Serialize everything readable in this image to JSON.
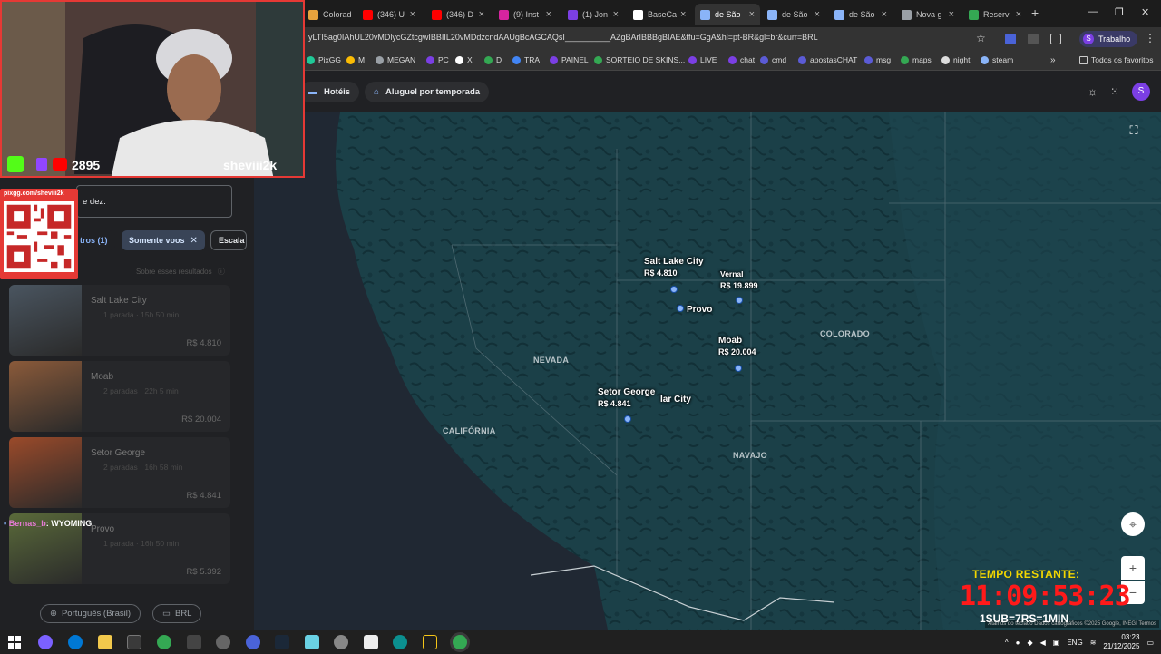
{
  "browser": {
    "tabs": [
      {
        "label": "Colorad",
        "color": "#e8a33d"
      },
      {
        "label": "(346) U",
        "color": "#ff0000"
      },
      {
        "label": "(346) D",
        "color": "#ff0000"
      },
      {
        "label": "(9) Inst",
        "color": "#d6249f"
      },
      {
        "label": "(1) Jon",
        "color": "#7b3fe4"
      },
      {
        "label": "BaseCa",
        "color": "#ffffff"
      },
      {
        "label": "de São",
        "color": "#8ab4f8",
        "active": true
      },
      {
        "label": "de São",
        "color": "#8ab4f8"
      },
      {
        "label": "de São",
        "color": "#8ab4f8"
      },
      {
        "label": "Nova g",
        "color": "#9aa0a6"
      },
      {
        "label": "Reserv",
        "color": "#34a853"
      }
    ],
    "url": "yLTI5ag0IAhUL20vMDlycGZtcgwIBBIIL20vMDdzcndAAUgBcAGCAQsI__________AZgBArIBBBgBIAE&tfu=GgA&hl=pt-BR&gl=br&curr=BRL",
    "profile_label": "Trabalho",
    "profile_initial": "S",
    "bookmarks": [
      {
        "label": "PixGG",
        "color": "#20c997"
      },
      {
        "label": "M",
        "color": "#fbbc04"
      },
      {
        "label": "MEGAN",
        "color": "#9aa0a6"
      },
      {
        "label": "PC",
        "color": "#7b3fe4"
      },
      {
        "label": "X",
        "color": "#ffffff"
      },
      {
        "label": "D",
        "color": "#34a853"
      },
      {
        "label": "TRA",
        "color": "#4285f4"
      },
      {
        "label": "PAINEL",
        "color": "#7b3fe4"
      },
      {
        "label": "SORTEIO DE SKINS...",
        "color": "#34a853"
      },
      {
        "label": "LIVE",
        "color": "#7b3fe4"
      },
      {
        "label": "chat",
        "color": "#7b3fe4"
      },
      {
        "label": "cmd",
        "color": "#5b5bd6"
      },
      {
        "label": "apostasCHAT",
        "color": "#5b5bd6"
      },
      {
        "label": "msg",
        "color": "#5b5bd6"
      },
      {
        "label": "maps",
        "color": "#34a853"
      },
      {
        "label": "night",
        "color": "#dddddd"
      },
      {
        "label": "steam",
        "color": "#8ab4f8"
      }
    ],
    "bookmarks_more": "Todos os favoritos"
  },
  "header": {
    "hotels_label": "Hotéis",
    "rentals_label": "Aluguel por temporada"
  },
  "sidebar": {
    "search_text": "e dez.",
    "filters_label": "tros (1)",
    "only_flights_label": "Somente voos",
    "stops_label": "Escala",
    "results_note": "Sobre esses resultados",
    "cards": [
      {
        "name": "Salt Lake City",
        "details": "1 parada · 15h 50 min",
        "price": "R$ 4.810",
        "color": "#4a5560"
      },
      {
        "name": "Moab",
        "details": "2 paradas · 22h 5 min",
        "price": "R$ 20.004",
        "color": "#8a5a3a"
      },
      {
        "name": "Setor George",
        "details": "2 paradas · 16h 58 min",
        "price": "R$ 4.841",
        "color": "#9a4a2a"
      },
      {
        "name": "Provo",
        "details": "1 parada · 16h 50 min",
        "price": "R$ 5.392",
        "color": "#5a6a3a"
      }
    ],
    "language_label": "Português (Brasil)",
    "currency_label": "BRL"
  },
  "map": {
    "regions": {
      "nevada": "NEVADA",
      "colorado": "COLORADO",
      "california": "CALIFÓRNIA",
      "navajo": "NAVAJO"
    },
    "destinations": [
      {
        "name": "Salt Lake City",
        "price": "R$ 4.810"
      },
      {
        "name": "Vernal",
        "price": "R$ 19.899"
      },
      {
        "name": "Provo",
        "price": ""
      },
      {
        "name": "Moab",
        "price": "R$ 20.004"
      },
      {
        "name": "Setor George",
        "price": "R$ 4.841"
      },
      {
        "name": "lar City",
        "price": ""
      }
    ],
    "zoom_in": "+",
    "zoom_out": "−",
    "attribution": "Atalhos do teclado  Dados cartográficos ©2025 Google, INEGI  Termos"
  },
  "stream": {
    "viewer_count": "2895",
    "streamer_name": "sheviii2k",
    "qr_url": "pixgg.com/sheviii2k",
    "chat_user": "Bernas_b",
    "chat_text": ": WYOMING",
    "timer_label": "TEMPO RESTANTE:",
    "timer_value": "11:09:53:23",
    "timer_rule": "1SUB=7RS=1MIN"
  },
  "taskbar": {
    "language": "ENG",
    "time": "03:23",
    "date": "21/12/2025"
  }
}
